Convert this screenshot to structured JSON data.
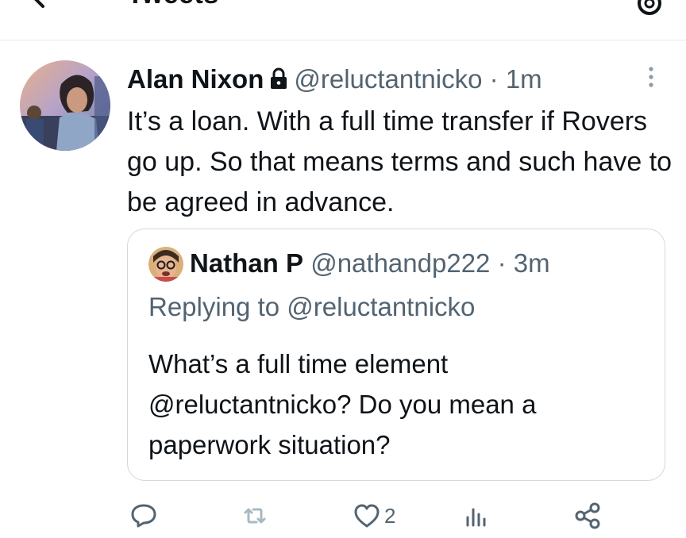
{
  "header": {
    "title": "Tweets"
  },
  "tweet": {
    "author": {
      "name": "Alan Nixon",
      "handle": "@reluctantnicko"
    },
    "separator": "·",
    "time": "1m",
    "text": "It’s a loan. With a full time transfer if Rovers go up. So that means terms and such have to be agreed in advance.",
    "quoted": {
      "name": "Nathan P",
      "handle": "@nathandp222",
      "separator": "·",
      "time": "3m",
      "replying_to": "Replying to @reluctantnicko",
      "text": "What’s a full time element @reluctantnicko? Do you mean a paperwork situation?"
    },
    "actions": {
      "like_count": "2"
    }
  },
  "icons": [
    "back-icon",
    "settings-icon",
    "lock-icon",
    "more-icon",
    "reply-icon",
    "retweet-icon",
    "like-icon",
    "views-icon",
    "share-icon"
  ],
  "colors": {
    "text": "#0f1419",
    "muted": "#536471",
    "border": "#cfd9de"
  }
}
